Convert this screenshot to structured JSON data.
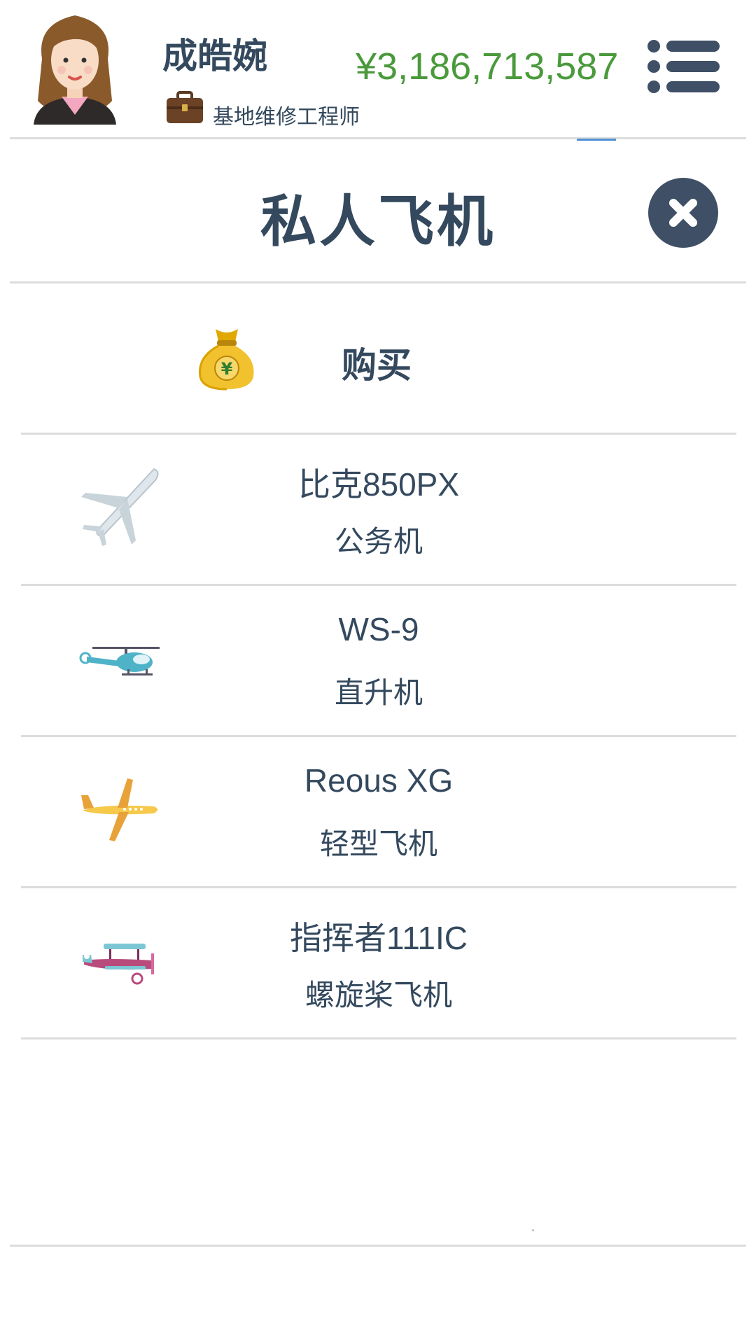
{
  "header": {
    "user_name": "成皓婉",
    "job_title": "基地维修工程师",
    "money": "¥3,186,713,587",
    "menu_icon": "hamburger-menu-icon"
  },
  "modal": {
    "title": "私人飞机",
    "close_icon": "close-icon"
  },
  "buy_section": {
    "icon": "money-bag-icon",
    "label": "购买"
  },
  "aircraft": [
    {
      "icon": "jet-airplane-icon",
      "name": "比克850PX",
      "type": "公务机"
    },
    {
      "icon": "helicopter-icon",
      "name": "WS-9",
      "type": "直升机"
    },
    {
      "icon": "light-aircraft-icon",
      "name": "Reous XG",
      "type": "轻型飞机"
    },
    {
      "icon": "biplane-icon",
      "name": "指挥者111IC",
      "type": "螺旋桨飞机"
    }
  ],
  "colors": {
    "text": "#34495e",
    "money": "#4a9a3c",
    "close_bg": "#3f5066",
    "divider": "#dcdcdc"
  }
}
